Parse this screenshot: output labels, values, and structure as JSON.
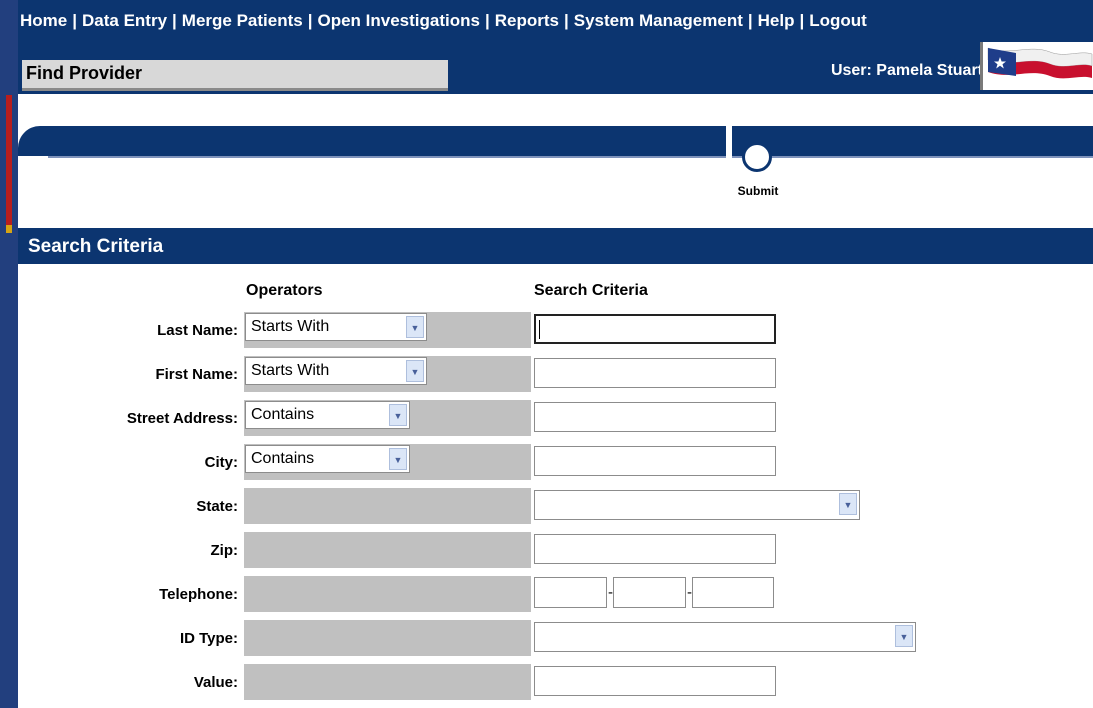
{
  "nav": {
    "links": [
      "Home",
      "Data Entry",
      "Merge Patients",
      "Open Investigations",
      "Reports",
      "System Management",
      "Help",
      "Logout"
    ],
    "separator": "|"
  },
  "header": {
    "page_title": "Find Provider",
    "user_label": "User: Pamela Stuart"
  },
  "toolbar": {
    "submit_label": "Submit"
  },
  "search": {
    "section_title": "Search Criteria",
    "operators_header": "Operators",
    "criteria_header": "Search Criteria",
    "fields": {
      "last_name": {
        "label": "Last Name:",
        "operator": "Starts With",
        "value": ""
      },
      "first_name": {
        "label": "First Name:",
        "operator": "Starts With",
        "value": ""
      },
      "street_address": {
        "label": "Street Address:",
        "operator": "Contains",
        "value": ""
      },
      "city": {
        "label": "City:",
        "operator": "Contains",
        "value": ""
      },
      "state": {
        "label": "State:",
        "value": ""
      },
      "zip": {
        "label": "Zip:",
        "value": ""
      },
      "telephone": {
        "label": "Telephone:",
        "area": "",
        "prefix": "",
        "line": "",
        "dash": "-"
      },
      "id_type": {
        "label": "ID Type:",
        "value": ""
      },
      "value": {
        "label": "Value:",
        "value": ""
      }
    }
  },
  "colors": {
    "brand_navy": "#0c3570",
    "operator_cell_gray": "#c0c0c0",
    "title_box_gray": "#d8d8d8"
  }
}
